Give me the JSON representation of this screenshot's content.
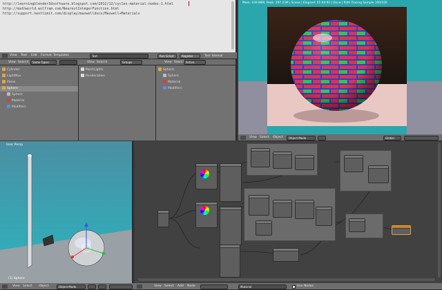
{
  "text_editor": {
    "lines": [
      "http://learningblender3dsoftware.blogspot.com/2012/12/cycles-material-nodes-1.html",
      "http://mathworld.wolfram.com/NearestIntegerFunction.html",
      "http://support.nextlimit.com/display/maxwelldocs/Maxwell+Materials"
    ],
    "menu": [
      "View",
      "Text",
      "Edit",
      "Format",
      "Templates"
    ],
    "script_name": "Text",
    "run_script": "Run Script",
    "register": "Register",
    "text_internal": "Text: Internal"
  },
  "outliner_1": {
    "menu": [
      "View",
      "Search"
    ],
    "dropdown": "Same Types",
    "items": [
      "Cylinder",
      "LightMax",
      "Plane",
      "Sphere",
      "Sphere",
      "Material",
      "Modifiers"
    ]
  },
  "outliner_2": {
    "menu": [
      "View",
      "Search"
    ],
    "dropdown": "Groups",
    "items": [
      "MeshLights",
      "Renderables"
    ]
  },
  "outliner_3": {
    "menu": [
      "View",
      "Search"
    ],
    "dropdown": "Active",
    "items": [
      "Sphere",
      "Sphere",
      "Material",
      "Modifiers"
    ]
  },
  "render_view": {
    "status": "Mem: 109.98M, Peak: 297.23M | Scene | Elapsed: 01:44:90 | Done | Path Tracing Sample 100/100",
    "menu": [
      "View",
      "Select",
      "Object"
    ],
    "mode": "Object Mode",
    "orientation": "Global"
  },
  "viewport_3d": {
    "label": "User Persp",
    "object_label": "(1) Sphere",
    "menu": [
      "View",
      "Select",
      "Object"
    ],
    "mode": "Object Mode"
  },
  "node_editor": {
    "menu": [
      "View",
      "Select",
      "Add",
      "Node"
    ],
    "material": "Material",
    "use_nodes": "Use Nodes"
  },
  "colors": {
    "viewport_top": "#4a8fa3",
    "viewport_bottom": "#2bb5bf",
    "render_bg": "#2aa7ad",
    "brick_red": "#e03350",
    "brick_green": "#39c64a",
    "mortar_blue": "#2f3fd0",
    "node_bg": "#5a5a5a"
  }
}
